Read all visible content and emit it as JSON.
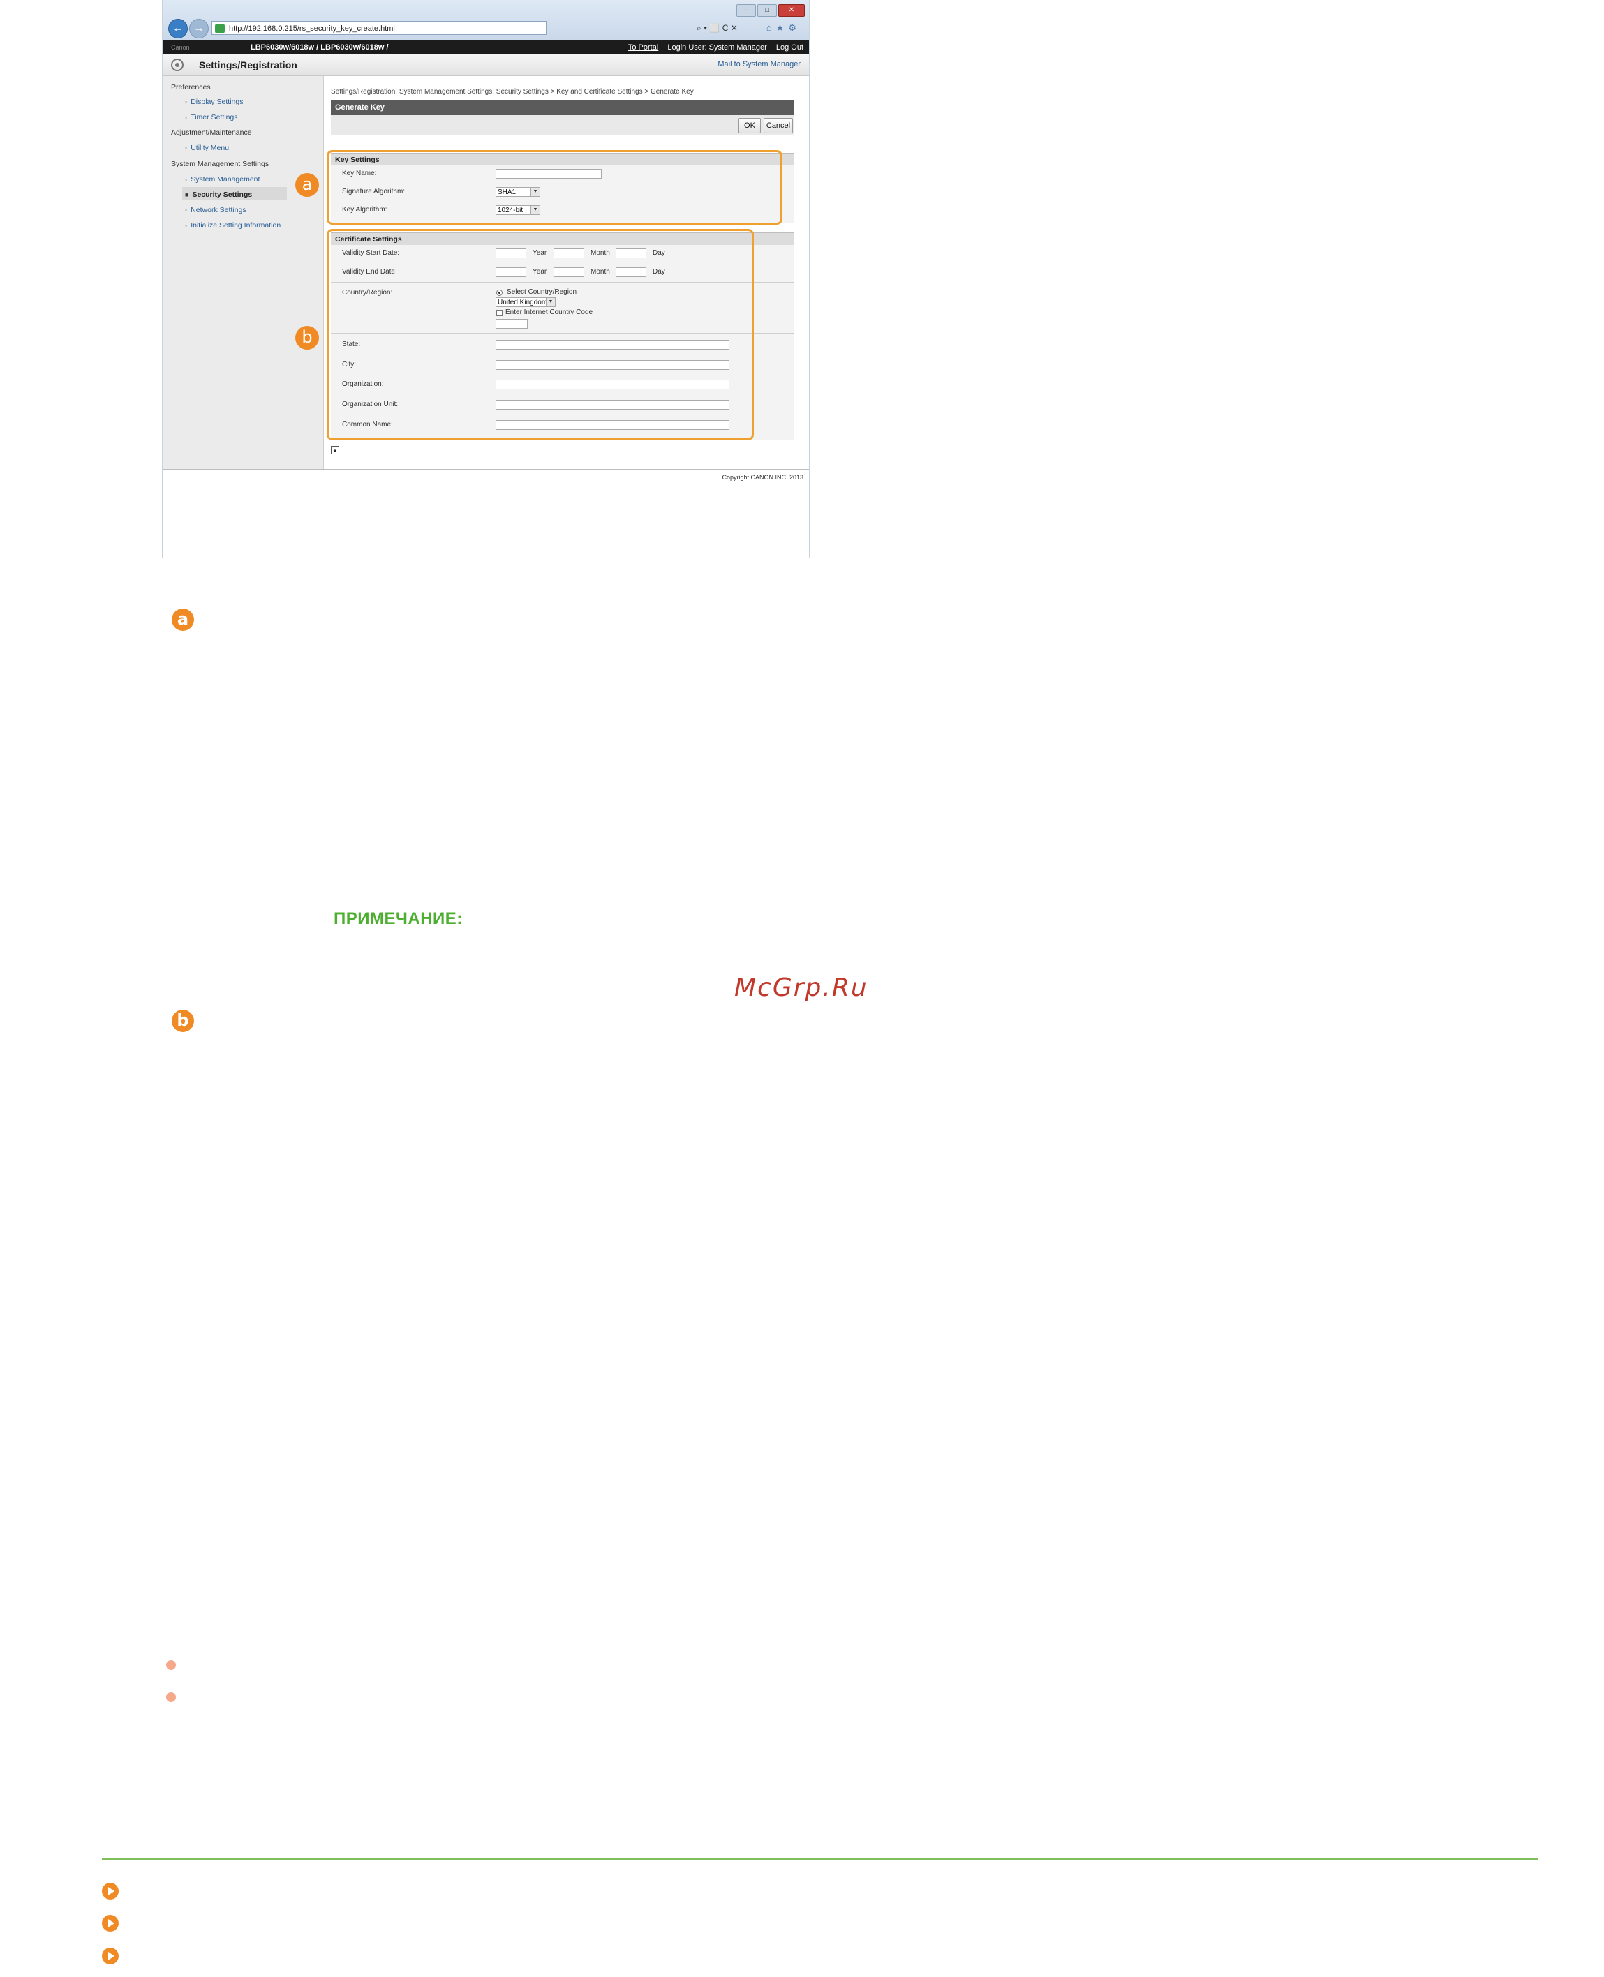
{
  "browser": {
    "url": "http://192.168.0.215/rs_security_key_create.html",
    "tools": "⌕ ▾ ⬜ C ✕",
    "window_buttons": [
      "–",
      "□",
      "✕"
    ]
  },
  "device_bar": {
    "brand": "Canon",
    "model": "LBP6030w/6018w / LBP6030w/6018w /",
    "portal": "To Portal",
    "login_user": "Login User: System Manager",
    "logout": "Log Out"
  },
  "settings_bar": {
    "title": "Settings/Registration",
    "mail": "Mail to System Manager"
  },
  "sidebar": {
    "preferences": "Preferences",
    "display_settings": "Display Settings",
    "timer_settings": "Timer Settings",
    "adjustment": "Adjustment/Maintenance",
    "utility_menu": "Utility Menu",
    "system_mgmt_settings": "System Management Settings",
    "system_management": "System Management",
    "security_settings": "Security Settings",
    "network_settings": "Network Settings",
    "initialize": "Initialize Setting Information"
  },
  "main": {
    "breadcrumb": "Settings/Registration: System Management Settings: Security Settings > Key and Certificate Settings > Generate Key",
    "page_title": "Generate Key",
    "ok_label": "OK",
    "cancel_label": "Cancel",
    "key_settings": {
      "header": "Key Settings",
      "key_name_label": "Key Name:",
      "key_name_value": "",
      "sig_alg_label": "Signature Algorithm:",
      "sig_alg_value": "SHA1",
      "key_alg_label": "Key Algorithm:",
      "key_alg_value": "1024-bit"
    },
    "cert_settings": {
      "header": "Certificate Settings",
      "validity_start_label": "Validity Start Date:",
      "validity_end_label": "Validity End Date:",
      "year": "Year",
      "month": "Month",
      "day": "Day",
      "country_label": "Country/Region:",
      "select_country": "Select Country/Region",
      "country_value": "United Kingdom (GB)",
      "enter_code": "Enter Internet Country Code",
      "state_label": "State:",
      "city_label": "City:",
      "org_label": "Organization:",
      "org_unit_label": "Organization Unit:",
      "common_name_label": "Common Name:"
    },
    "copyright": "Copyright CANON INC. 2013"
  },
  "callouts": {
    "a": "a",
    "b": "b"
  },
  "body": {
    "note_label": "ПРИМЕЧАНИЕ:",
    "watermark": "McGrp.Ru"
  },
  "colors": {
    "accent_orange": "#f08a24",
    "note_green": "#4caf2f",
    "watermark_red": "#c0392b",
    "rule_green": "#7fbf5a"
  }
}
